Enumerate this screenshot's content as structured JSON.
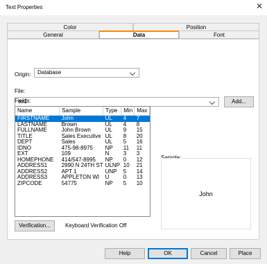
{
  "window": {
    "title": "Text Properties",
    "close": "✕"
  },
  "tabs_back": [
    "Color",
    "Position"
  ],
  "tabs_front": [
    "General",
    "Data",
    "Font"
  ],
  "origin": {
    "label": "Origin:",
    "value": "Database"
  },
  "file": {
    "label": "File:",
    "value": "ex1",
    "add_label": "Add..."
  },
  "fields": {
    "label": "Fields:",
    "columns": [
      "Name",
      "Sample",
      "Type",
      "Min",
      "Max"
    ],
    "rows": [
      [
        "FIRSTNAME",
        "John",
        "UL",
        "4",
        "7"
      ],
      [
        "LASTNAME",
        "Brown",
        "UL",
        "4",
        "8"
      ],
      [
        "FULLNAME",
        "John Brown",
        "UL",
        "9",
        "15"
      ],
      [
        "TITLE",
        "Sales Executive",
        "UL",
        "8",
        "20"
      ],
      [
        "DEPT",
        "Sales",
        "UL",
        "5",
        "16"
      ],
      [
        "IDNO",
        "475-98-8975",
        "NP",
        "11",
        "11"
      ],
      [
        "EXT",
        "109",
        "N",
        "3",
        "3"
      ],
      [
        "HOMEPHONE",
        "414/547-8995",
        "NP",
        "0",
        "12"
      ],
      [
        "ADDRESS1",
        "2990 N 24TH ST",
        "ULNP",
        "10",
        "21"
      ],
      [
        "ADDRESS2",
        "APT 1",
        "UNP",
        "5",
        "14"
      ],
      [
        "ADDRESS3",
        "APPLETON WI",
        "U",
        "0",
        "13"
      ],
      [
        "ZIPCODE",
        "54775",
        "NP",
        "5",
        "10"
      ]
    ],
    "selected_index": 0
  },
  "sample": {
    "label": "Sample:",
    "value": "John"
  },
  "verification": {
    "button": "Verification...",
    "status": "Keyboard Verification Off"
  },
  "footer": {
    "help": "Help",
    "ok": "OK",
    "cancel": "Cancel",
    "place": "Place"
  },
  "colors": {
    "accent": "#f28c00",
    "selection": "#0078d7"
  }
}
